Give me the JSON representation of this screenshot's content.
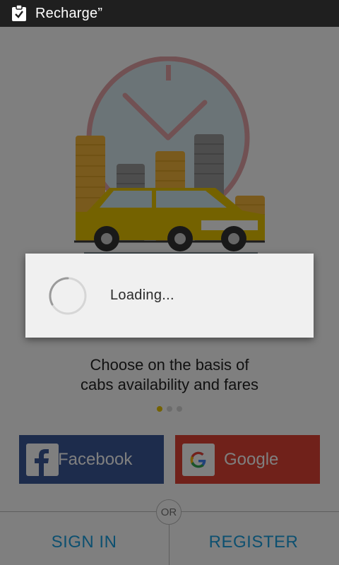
{
  "status_bar": {
    "title": "Recharge”",
    "icon": "clipboard-check-icon"
  },
  "hero": {
    "icon": "taxi-clock-coins-illustration"
  },
  "caption": {
    "line1": "Choose on the basis of",
    "line2": "cabs availability and fares"
  },
  "pager": {
    "total": 3,
    "active": 1
  },
  "social": {
    "facebook_label": "Facebook",
    "google_label": "Google"
  },
  "divider": {
    "or_label": "OR"
  },
  "actions": {
    "sign_in_label": "SIGN IN",
    "register_label": "REGISTER"
  },
  "dialog": {
    "loading_text": "Loading..."
  },
  "colors": {
    "facebook": "#3b5998",
    "google": "#e04335",
    "accent": "#1aa0e0",
    "dot_active": "#e8c400"
  }
}
